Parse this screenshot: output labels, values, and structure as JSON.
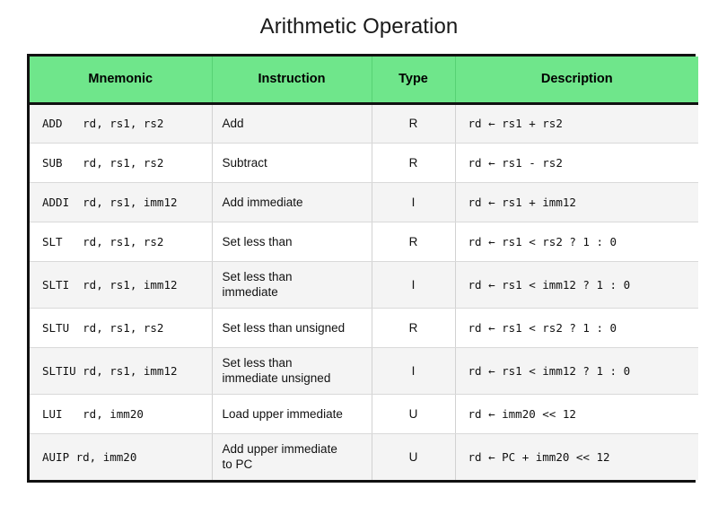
{
  "title": "Arithmetic Operation",
  "colors": {
    "header_green": "#6FE68B",
    "border_dark": "#111111",
    "row_alt": "#f4f4f4",
    "row_base": "#ffffff",
    "text": "#111111"
  },
  "table": {
    "columns": [
      {
        "key": "mnemonic",
        "label": "Mnemonic"
      },
      {
        "key": "instruction",
        "label": "Instruction"
      },
      {
        "key": "type",
        "label": "Type"
      },
      {
        "key": "description",
        "label": "Description"
      }
    ],
    "rows": [
      {
        "mnemonic": "ADD   rd, rs1, rs2",
        "instruction": "Add",
        "type": "R",
        "description": "rd ← rs1 + rs2"
      },
      {
        "mnemonic": "SUB   rd, rs1, rs2",
        "instruction": "Subtract",
        "type": "R",
        "description": "rd ← rs1 - rs2"
      },
      {
        "mnemonic": "ADDI  rd, rs1, imm12",
        "instruction": "Add immediate",
        "type": "I",
        "description": "rd ← rs1 + imm12"
      },
      {
        "mnemonic": "SLT   rd, rs1, rs2",
        "instruction": "Set less than",
        "type": "R",
        "description": "rd ← rs1 < rs2 ? 1 : 0"
      },
      {
        "mnemonic": "SLTI  rd, rs1, imm12",
        "instruction": "Set less than\nimmediate",
        "type": "I",
        "description": "rd ← rs1 < imm12 ? 1 : 0"
      },
      {
        "mnemonic": "SLTU  rd, rs1, rs2",
        "instruction": "Set less than unsigned",
        "type": "R",
        "description": "rd ← rs1 < rs2 ? 1 : 0"
      },
      {
        "mnemonic": "SLTIU rd, rs1, imm12",
        "instruction": "Set less than\nimmediate  unsigned",
        "type": "I",
        "description": "rd ← rs1 < imm12 ? 1 : 0"
      },
      {
        "mnemonic": "LUI   rd, imm20",
        "instruction": "Load upper immediate",
        "type": "U",
        "description": "rd ← imm20 << 12"
      },
      {
        "mnemonic": "AUIP rd, imm20",
        "instruction": "Add upper immediate\nto PC",
        "type": "U",
        "description": "rd ← PC + imm20 << 12"
      }
    ]
  }
}
